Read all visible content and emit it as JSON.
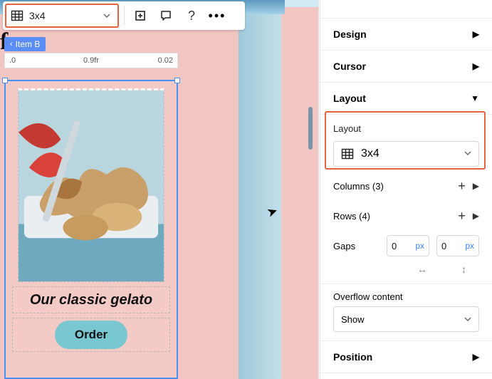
{
  "toolbar": {
    "grid_value": "3x4"
  },
  "item_tag": "Item B",
  "ruler": {
    "start": ".0",
    "mid": "0.9fr",
    "end": "0.02"
  },
  "card": {
    "caption": "Our classic gelato",
    "button": "Order"
  },
  "panel": {
    "design": "Design",
    "cursor": "Cursor",
    "layout_header": "Layout",
    "layout_label": "Layout",
    "layout_value": "3x4",
    "columns_label": "Columns (3)",
    "rows_label": "Rows (4)",
    "gaps_label": "Gaps",
    "gap_h": "0",
    "gap_v": "0",
    "unit": "px",
    "overflow_label": "Overflow content",
    "overflow_value": "Show",
    "position": "Position"
  }
}
